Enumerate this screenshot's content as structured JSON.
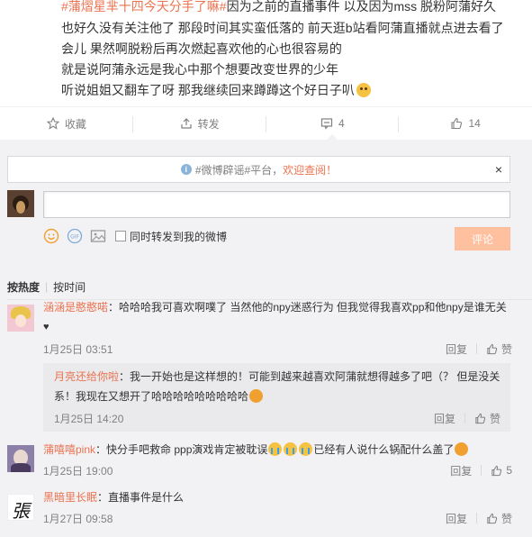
{
  "post": {
    "lines": [
      {
        "hashtag": "#蒲熠星芈十四今天分手了嘛#",
        "text": "因为之前的直播事件 以及因为mss 脱粉阿蒲好久"
      },
      {
        "text": "也好久没有关注他了 那段时间其实蛮低落的 前天逛b站看阿蒲直播就点进去看了"
      },
      {
        "text": "会儿 果然啊脱粉后再次燃起喜欢他的心也很容易的"
      },
      {
        "text": "就是说阿蒲永远是我心中那个想要改变世界的少年"
      },
      {
        "text": "听说姐姐又翻车了呀 那我继续回来蹲蹲这个好日子叭"
      }
    ]
  },
  "actions": {
    "favorite": "收藏",
    "repost": "转发",
    "comment_count": "4",
    "like_count": "14"
  },
  "notice": {
    "prefix": "#微博辟谣#平台，",
    "link": "欢迎查阅！",
    "close": "×"
  },
  "composer": {
    "forward_label": "同时转发到我的微博",
    "submit": "评论"
  },
  "sort": {
    "selected": "按热度",
    "separator": "|",
    "other": "按时间"
  },
  "comments": [
    {
      "user": "涵涵是憨憨喏",
      "text": "：哈哈哈我可喜欢啊噗了 当然他的npy迷惑行为 但我觉得我喜欢pp和他npy是谁无关",
      "text2": "♥",
      "time": "1月25日 03:51",
      "reply": "回复",
      "like": "赞"
    },
    {
      "user": "月亮还给你啦",
      "text": "：我一开始也是这样想的！可能到越来越喜欢阿蒲就想得越多了吧（？ 但是没关",
      "text2": "系！我现在又想开了哈哈哈哈哈哈哈哈哈",
      "time": "1月25日 14:20",
      "reply": "回复",
      "like": "赞"
    },
    {
      "user": "蒲嘻嘻pink",
      "text": "：快分手吧救命 ppp演戏肯定被耽误",
      "text_after": "已经有人说什么锅配什么盖了",
      "time": "1月25日 19:00",
      "reply": "回复",
      "like": "5"
    },
    {
      "user": "黑暗里长眠",
      "text": "：直播事件是什么",
      "avatar_text": "張",
      "time": "1月27日 09:58",
      "reply": "回复",
      "like": "赞"
    }
  ],
  "colors": {
    "accent": "#eb7350",
    "button_disabled": "#ffc09f",
    "panel": "#f2f2f5"
  }
}
